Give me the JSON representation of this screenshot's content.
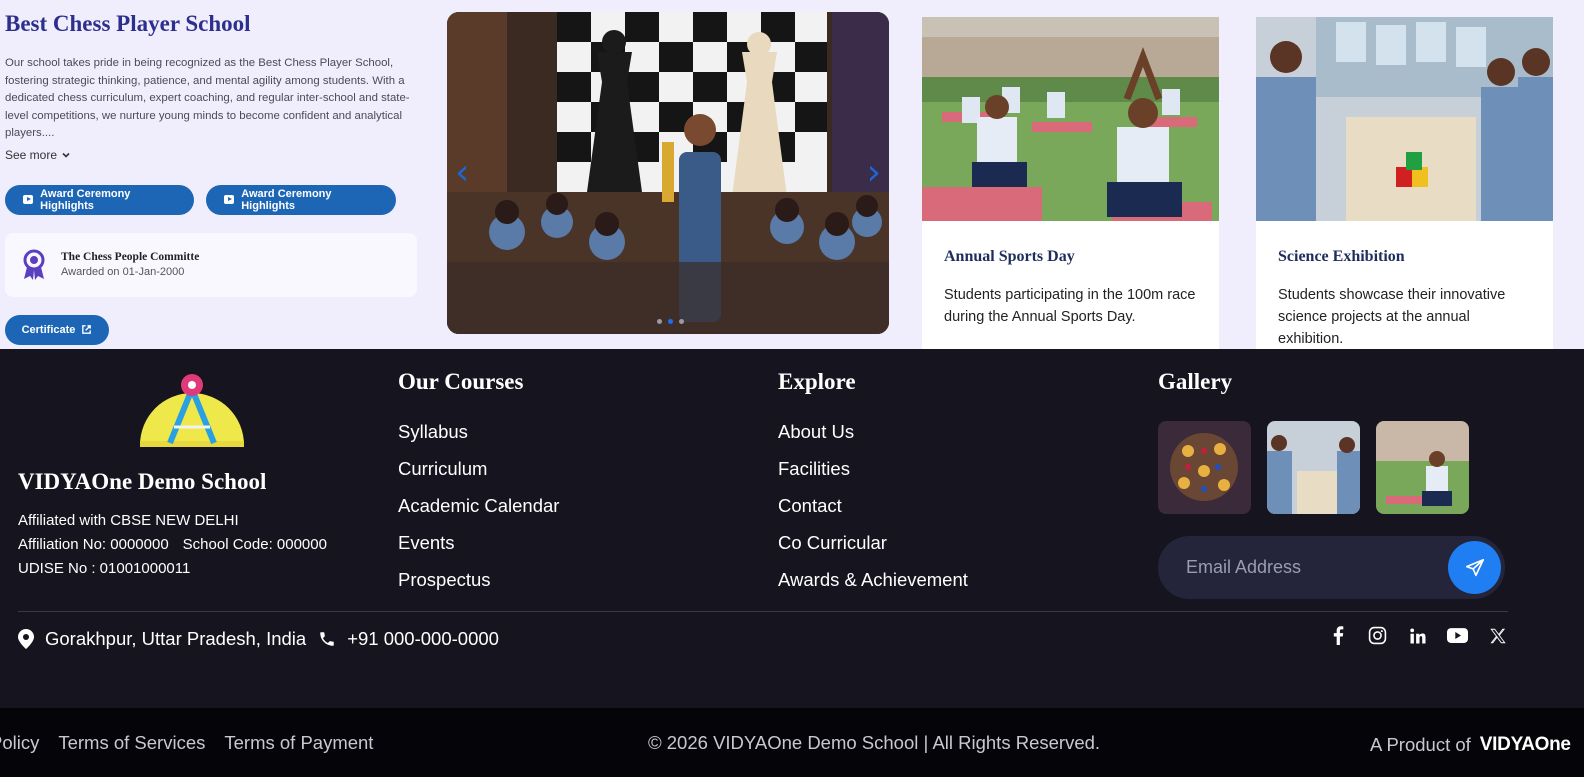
{
  "award": {
    "title": "Best Chess Player School",
    "description": "Our school takes pride in being recognized as the Best Chess Player School, fostering strategic thinking, patience, and mental agility among students. With a dedicated chess curriculum, expert coaching, and regular inter-school and state-level competitions, we nurture young minds to become confident and analytical players....",
    "see_more": "See more",
    "buttons": [
      "Award Ceremony Highlights",
      "Award Ceremony Highlights"
    ],
    "committee": {
      "name": "The Chess People Committe",
      "date": "Awarded on 01-Jan-2000"
    },
    "certificate": "Certificate"
  },
  "carousel": {
    "dots": 3,
    "active": 1,
    "prev_icon": "chevron-left-icon",
    "next_icon": "chevron-right-icon"
  },
  "events": [
    {
      "title": "Annual Sports Day",
      "description": "Students participating in the 100m race during the Annual Sports Day."
    },
    {
      "title": "Science Exhibition",
      "description": "Students showcase their innovative science projects at the annual exhibition."
    }
  ],
  "footer": {
    "school_name": "VIDYAOne Demo School",
    "affiliated": "Affiliated with CBSE NEW DELHI",
    "affiliation_no": "Affiliation No: 0000000",
    "school_code": "School Code: 000000",
    "udise": "UDISE No : 01001000011",
    "courses": {
      "heading": "Our Courses",
      "links": [
        "Syllabus",
        "Curriculum",
        "Academic Calendar",
        "Events",
        "Prospectus"
      ]
    },
    "explore": {
      "heading": "Explore",
      "links": [
        "About Us",
        "Facilities",
        "Contact",
        "Co Curricular",
        "Awards & Achievement"
      ]
    },
    "gallery": {
      "heading": "Gallery"
    },
    "email_placeholder": "Email Address",
    "address": "Gorakhpur, Uttar Pradesh, India",
    "phone": "+91 000-000-0000",
    "social": [
      "facebook-icon",
      "instagram-icon",
      "linkedin-icon",
      "youtube-icon",
      "x-icon"
    ]
  },
  "bottom": {
    "legal": [
      "Policy",
      "Terms of Services",
      "Terms of Payment"
    ],
    "copyright": "© 2026 VIDYAOne Demo School | All Rights Reserved.",
    "product_prefix": "A Product of",
    "brand": "VIDYAOne"
  },
  "colors": {
    "primary": "#1d66b5",
    "footer_bg": "#15141f",
    "bottom_bg": "#050408",
    "send": "#1f7ef2"
  }
}
